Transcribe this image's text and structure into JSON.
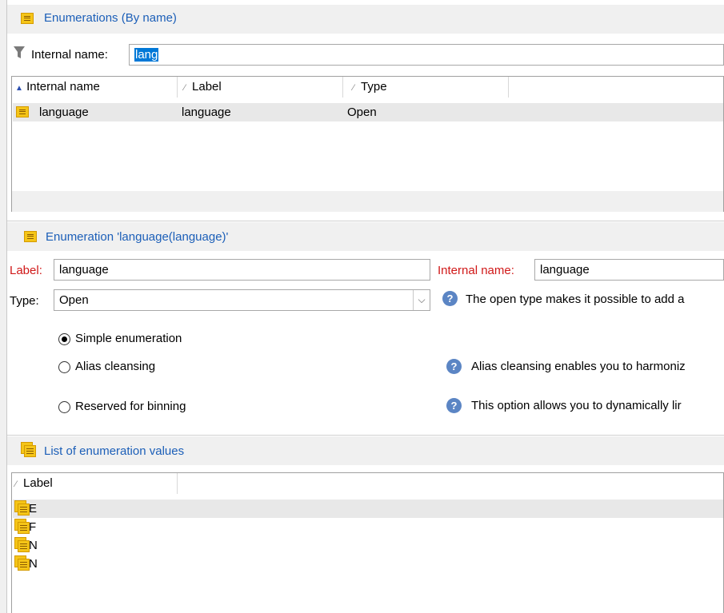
{
  "top_section": {
    "title": "Enumerations (By name)",
    "filter_label": "Internal name:",
    "filter_value": "lang"
  },
  "enum_list": {
    "columns": [
      "Internal name",
      "Label",
      "Type"
    ],
    "rows": [
      {
        "internal_name": "language",
        "label": "language",
        "type": "Open"
      }
    ]
  },
  "detail_section": {
    "title": "Enumeration 'language(language)'",
    "label_caption": "Label:",
    "label_value": "language",
    "internal_name_caption": "Internal name:",
    "internal_name_value": "language",
    "type_caption": "Type:",
    "type_value": "Open",
    "type_help": "The open type makes it possible to add a",
    "radios": [
      {
        "label": "Simple enumeration",
        "selected": true
      },
      {
        "label": "Alias cleansing",
        "selected": false
      },
      {
        "label": "Reserved for binning",
        "selected": false
      }
    ],
    "alias_help": "Alias cleansing enables you to harmoniz",
    "binning_help": "This option allows you to dynamically lir"
  },
  "values_section": {
    "title": "List of enumeration values",
    "column": "Label",
    "rows": [
      "E",
      "F",
      "N",
      "N"
    ]
  },
  "colors": {
    "accent_blue": "#1c5fb8",
    "required_red": "#d01818",
    "selection_blue": "#0078d7",
    "icon_yellow": "#f5c518"
  }
}
